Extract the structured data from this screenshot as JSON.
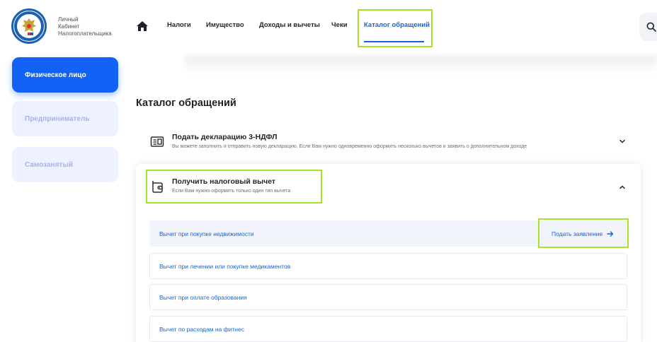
{
  "header": {
    "logo_lines": [
      "Личный",
      "Кабинет",
      "Налогоплательщика"
    ],
    "nav": [
      {
        "label": "Налоги"
      },
      {
        "label": "Имущество"
      },
      {
        "label": "Доходы и вычеты"
      },
      {
        "label": "Чеки"
      },
      {
        "label": "Каталог обращений"
      }
    ],
    "active_nav": "Каталог обращений",
    "icons": {
      "home": "home-icon",
      "search": "search-icon"
    }
  },
  "sidebar": {
    "items": [
      {
        "label": "Физическое лицо",
        "active": true
      },
      {
        "label": "Предприниматель",
        "active": false
      },
      {
        "label": "Самозанятый",
        "active": false
      }
    ]
  },
  "main": {
    "title": "Каталог обращений",
    "accordion": [
      {
        "title": "Подать декларацию 3-НДФЛ",
        "description": "Вы можете заполнить и отправить новую декларацию. Если Вам нужно одновременно оформить несколько вычетов и заявить о дополнительном доходе",
        "expanded": false,
        "icon": "document-icon"
      },
      {
        "title": "Получить налоговый вычет",
        "description": "Если Вам нужно оформить только один тип вычета",
        "expanded": true,
        "icon": "wallet-icon",
        "items": [
          {
            "label": "Вычет при покупке недвижимости",
            "action": "Подать заявление"
          },
          {
            "label": "Вычет при лечении или покупке медикаментов"
          },
          {
            "label": "Вычет при оплате образования"
          },
          {
            "label": "Вычет по расходам на фитнес"
          }
        ]
      }
    ]
  },
  "colors": {
    "accent": "#1565d8",
    "sidebar_active": "#1262f5",
    "sidebar_inactive_bg": "#eef1ff",
    "highlight": "#a8e02a"
  }
}
